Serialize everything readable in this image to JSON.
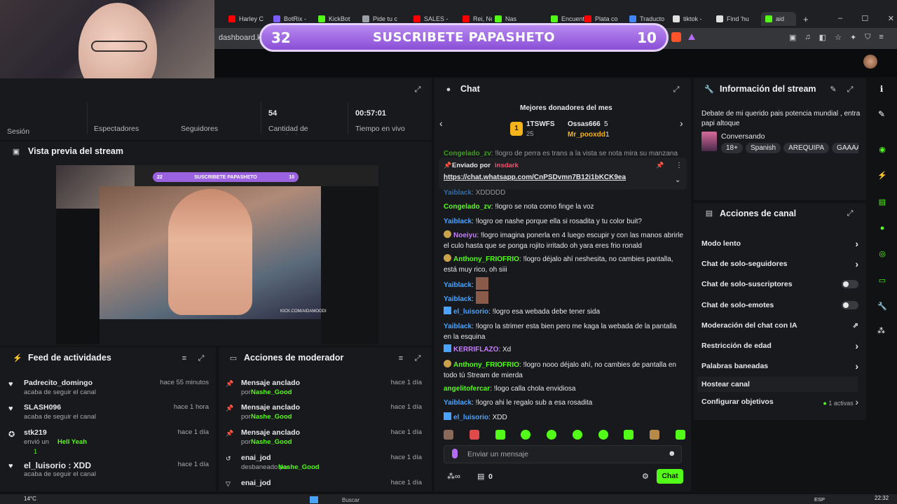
{
  "tabs": [
    {
      "label": "Harley C",
      "color": "#ff0000"
    },
    {
      "label": "BotRix -",
      "color": "#7b5cff"
    },
    {
      "label": "KickBot",
      "color": "#53fc18"
    },
    {
      "label": "Pide tu c",
      "color": "#9aa0a6"
    },
    {
      "label": "SALES -",
      "color": "#ff0000"
    },
    {
      "label": "Rei, Neo",
      "color": "#ff0000"
    },
    {
      "label": "Nas",
      "color": "#53fc18"
    },
    {
      "label": "Encuent",
      "color": "#53fc18"
    },
    {
      "label": "Plata co",
      "color": "#ff0000"
    },
    {
      "label": "Traducto",
      "color": "#4285f4"
    },
    {
      "label": "tiktok -",
      "color": "#e0e0e0"
    },
    {
      "label": "Find 'hu",
      "color": "#e0e0e0"
    },
    {
      "label": "aid",
      "color": "#53fc18"
    }
  ],
  "url": "dashboard.kick.",
  "banner": {
    "left_num": "32",
    "text": "SUSCRIBETE PAPASHETO",
    "right_num": "10"
  },
  "stats": {
    "session_label": "Sesión",
    "spectators_label": "Espectadores",
    "followers_label": "Seguidores",
    "subs_value": "54",
    "subs_label": "Cantidad de suscripciones",
    "time_value": "00:57:01",
    "time_label": "Tiempo en vivo"
  },
  "preview": {
    "title": "Vista previa del stream",
    "inner_banner": "SUSCRIBETE PAPASHETO",
    "inner_left": "22",
    "inner_right": "10",
    "footer": "KICK.COM/AIDAMOODI"
  },
  "feed": {
    "title": "Feed de actividades",
    "items": [
      {
        "name": "Padrecito_domingo",
        "sub": "acaba de seguir el canal",
        "time": "hace 55 minutos"
      },
      {
        "name": "SLASH096",
        "sub": "acaba de seguir el canal",
        "time": "hace 1 hora"
      },
      {
        "name": "stk219",
        "sub": "envió un",
        "extra": "Hell Yeah",
        "count": "1",
        "time": "hace 1 día"
      },
      {
        "name": "el_luisorio : XDD",
        "sub": "acaba de seguir el canal",
        "time": "hace 1 día"
      }
    ]
  },
  "mod": {
    "title": "Acciones de moderador",
    "items": [
      {
        "name": "Mensaje anclado",
        "by": "por",
        "user": "Nashe_Good",
        "time": "hace 1 día"
      },
      {
        "name": "Mensaje anclado",
        "by": "por",
        "user": "Nashe_Good",
        "time": "hace 1 día"
      },
      {
        "name": "Mensaje anclado",
        "by": "por",
        "user": "Nashe_Good",
        "time": "hace 1 día"
      },
      {
        "name": "enai_jod",
        "by": "desbaneado por",
        "user": "Nashe_Good",
        "time": "hace 1 día"
      },
      {
        "name": "enai_jod",
        "by": "",
        "user": "",
        "time": "hace 1 día"
      }
    ]
  },
  "chat": {
    "title": "Chat",
    "donors_title": "Mejores donadores del mes",
    "donors": [
      {
        "name": "1TSWFS",
        "val": "25"
      },
      {
        "name": "Ossas666",
        "val": "5"
      },
      {
        "name": "Mr_pooxdd",
        "val": "1"
      }
    ],
    "pinned_label": "Enviado por",
    "pinned_user": "insdark",
    "pinned_link": "https://chat.whatsapp.com/CnPSDvmn7B12i1bKCK9ea",
    "messages": [
      {
        "user": "Congelado_zv",
        "color": "#53fc18",
        "text": "!logro de perra es trans a la vista se nota mira su manzana en su"
      },
      {
        "user": "Yaiblack",
        "color": "#4aa3ff",
        "text": "XDDDDD"
      },
      {
        "user": "Congelado_zv",
        "color": "#53fc18",
        "text": "!logro se nota como finge la voz"
      },
      {
        "user": "Yaiblack",
        "color": "#4aa3ff",
        "text": "!logro oe nashe porque ella si rosadita y tu color buit?"
      },
      {
        "user": "Noeiyu",
        "color": "#c77dff",
        "text": "!logro imagina ponerla en 4 luego escupir y con las manos abrirle el culo hasta que se ponga rojito irritado oh yara eres frio ronald"
      },
      {
        "user": "Anthony_FRIOFRIO",
        "color": "#53fc18",
        "text": "!logro déjalo ahí neshesita, no cambies pantalla, está muy rico, oh siii"
      },
      {
        "user": "Yaiblack",
        "color": "#4aa3ff",
        "text": ""
      },
      {
        "user": "Yaiblack",
        "color": "#4aa3ff",
        "text": ""
      },
      {
        "user": "el_luisorio",
        "color": "#4aa3ff",
        "text": "!logro esa webada debe tener sida"
      },
      {
        "user": "Yaiblack",
        "color": "#4aa3ff",
        "text": "!logro la strimer esta bien pero me kaga la webada de la pantalla en la esquina"
      },
      {
        "user": "KERRIFLAZO",
        "color": "#c77dff",
        "text": "Xd"
      },
      {
        "user": "Anthony_FRIOFRIO",
        "color": "#53fc18",
        "text": "!logro nooo déjalo ahí, no cambies de pantalla en todo tú Stream de mierda"
      },
      {
        "user": "angelitofercar",
        "color": "#53fc18",
        "text": "!logo calla chola envidiosa"
      },
      {
        "user": "Yaiblack",
        "color": "#4aa3ff",
        "text": "!logro ahi le regalo sub a esa rosadita"
      },
      {
        "user": "el_luisorio",
        "color": "#4aa3ff",
        "text": "XDD"
      }
    ],
    "input_placeholder": "Enviar un mensaje",
    "count": "0",
    "send_label": "Chat"
  },
  "info": {
    "title": "Información del stream",
    "stream_title": "Debate de mi querido pais potencia mundial , entra papi altoque",
    "category": "Conversando",
    "tags": [
      "18+",
      "Spanish",
      "AREQUIPA",
      "GAAAAAA"
    ]
  },
  "actions": {
    "title": "Acciones de canal",
    "items": [
      {
        "label": "Modo lento",
        "kind": "chevron"
      },
      {
        "label": "Chat de solo-seguidores",
        "kind": "chevron"
      },
      {
        "label": "Chat de solo-suscriptores",
        "kind": "toggle"
      },
      {
        "label": "Chat de solo-emotes",
        "kind": "toggle"
      },
      {
        "label": "Moderación del chat con IA",
        "kind": "external"
      },
      {
        "label": "Restricción de edad",
        "kind": "chevron"
      },
      {
        "label": "Palabras baneadas",
        "kind": "chevron"
      },
      {
        "label": "Hostear canal",
        "kind": "none"
      },
      {
        "label": "Configurar objetivos",
        "kind": "goal",
        "extra": "1 activas"
      }
    ]
  },
  "taskbar": {
    "weather": "14°C",
    "search": "Buscar",
    "lang": "ESP",
    "clock": "22:32"
  }
}
